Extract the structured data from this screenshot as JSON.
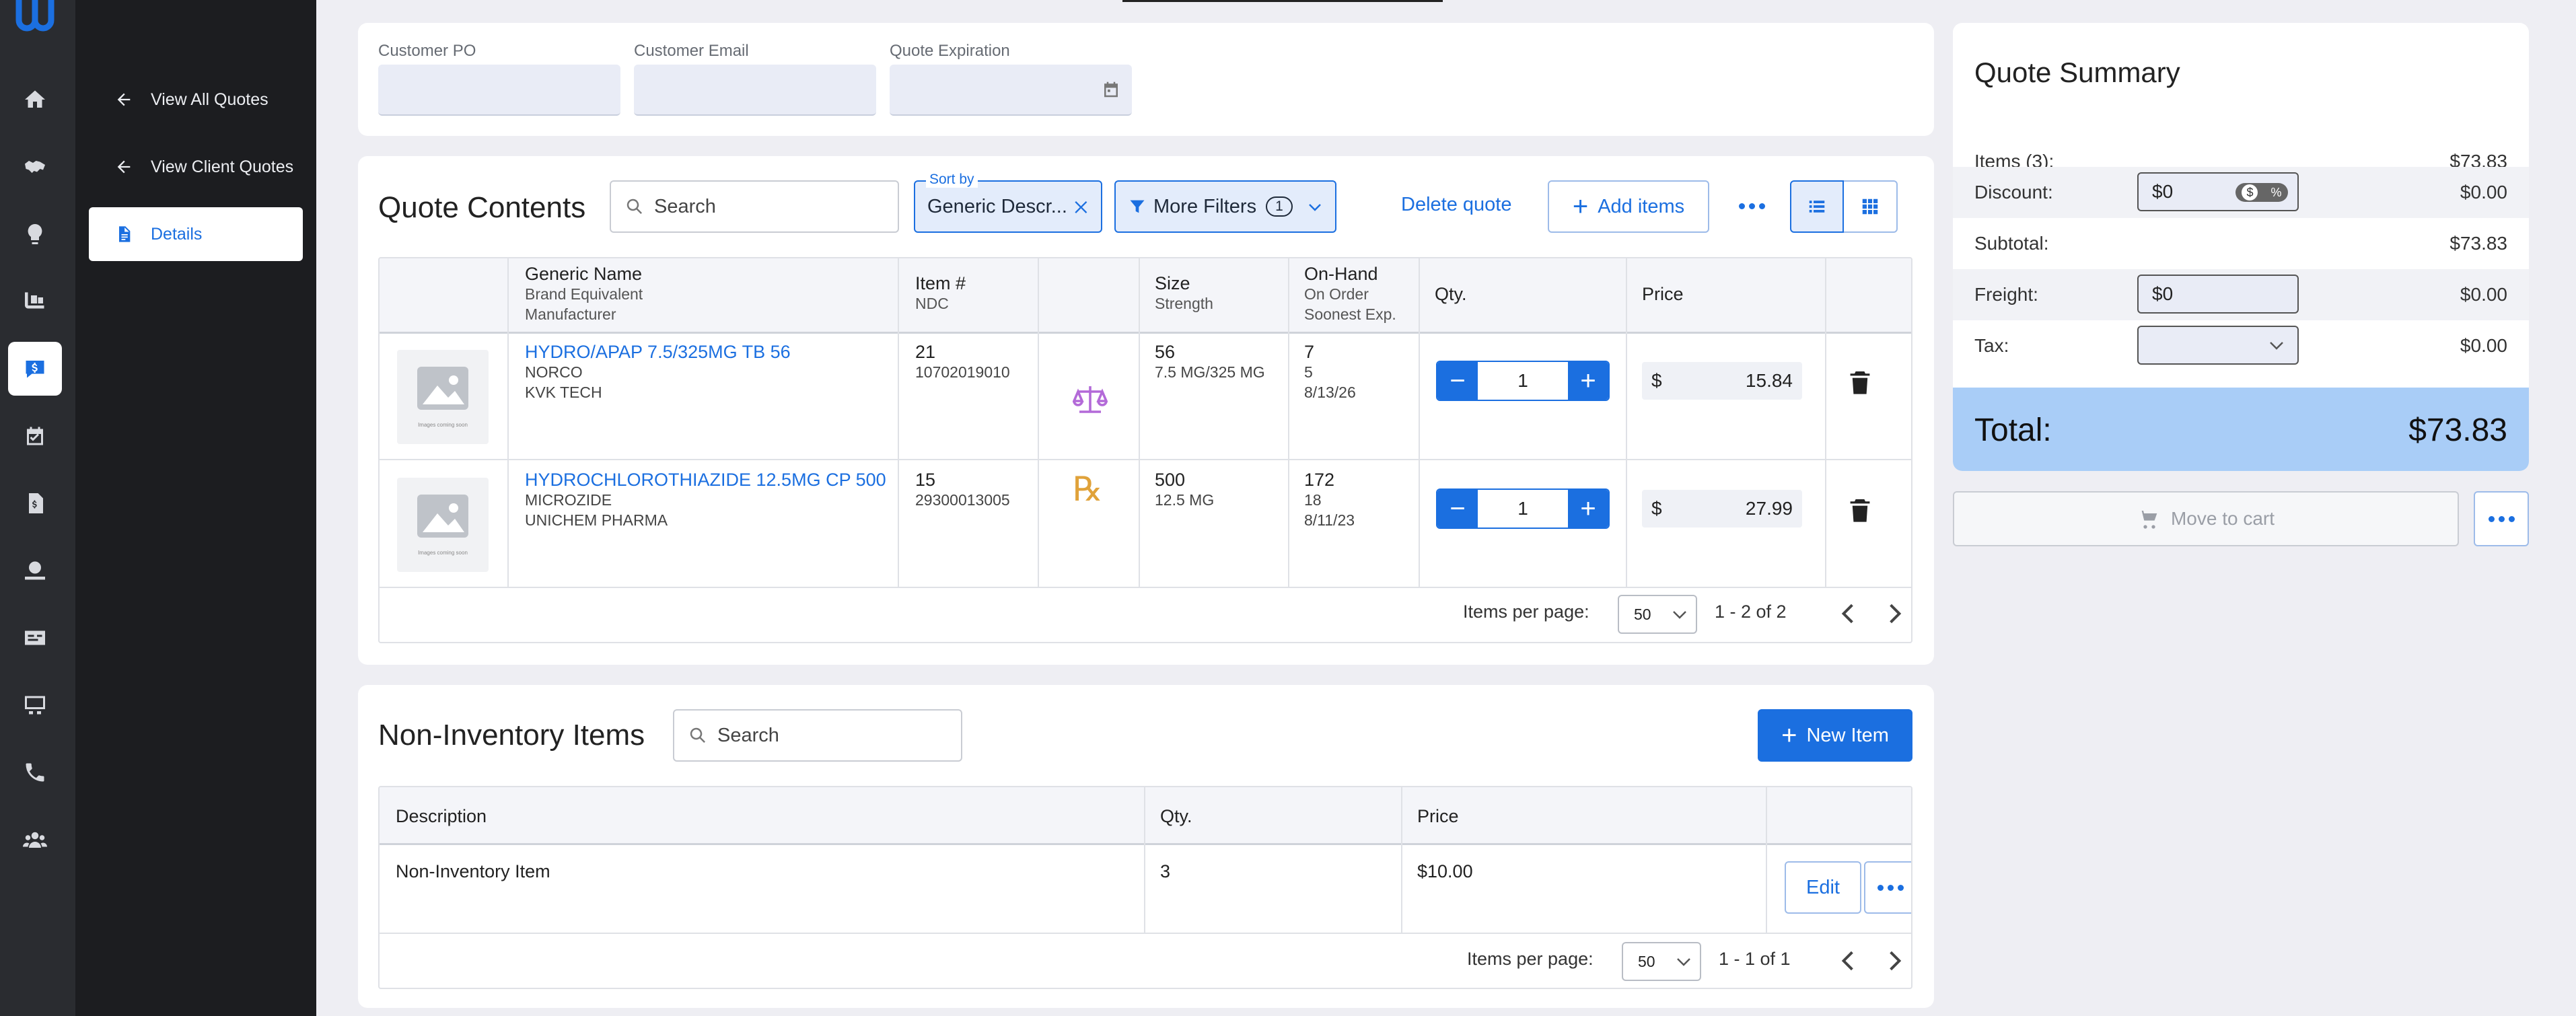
{
  "sidebar": {
    "back_all_quotes": "View All Quotes",
    "back_client_quotes": "View Client Quotes",
    "details": "Details"
  },
  "quote_info": {
    "po_label": "Customer PO",
    "po_value": "",
    "email_label": "Customer Email",
    "email_value": "",
    "expiration_label": "Quote Expiration",
    "expiration_value": ""
  },
  "quote_contents": {
    "title": "Quote Contents",
    "search_placeholder": "Search",
    "sort_legend": "Sort by",
    "sort_value": "Generic Descr...",
    "more_filters_label": "More Filters",
    "more_filters_count": "1",
    "delete_label": "Delete quote",
    "add_items_label": "Add items",
    "headers": {
      "generic": "Generic Name",
      "brand": "Brand Equivalent",
      "manufacturer": "Manufacturer",
      "item": "Item #",
      "ndc": "NDC",
      "size": "Size",
      "strength": "Strength",
      "onhand": "On-Hand",
      "onorder": "On Order",
      "soonest": "Soonest Exp.",
      "qty": "Qty.",
      "price": "Price"
    },
    "rows": [
      {
        "name": "HYDRO/APAP 7.5/325MG TB 56",
        "brand": "NORCO",
        "manufacturer": "KVK TECH",
        "item_no": "21",
        "ndc": "10702019010",
        "badge_icon": "scale-icon",
        "size": "56",
        "strength": "7.5 MG/325 MG",
        "on_hand": "7",
        "on_order": "5",
        "soonest_exp": "8/13/26",
        "qty": "1",
        "currency": "$",
        "price": "15.84"
      },
      {
        "name": "HYDROCHLOROTHIAZIDE 12.5MG CP 500",
        "brand": "MICROZIDE",
        "manufacturer": "UNICHEM PHARMA",
        "item_no": "15",
        "ndc": "29300013005",
        "badge_icon": "rx-icon",
        "badge_text": "℞",
        "size": "500",
        "strength": "12.5 MG",
        "on_hand": "172",
        "on_order": "18",
        "soonest_exp": "8/11/23",
        "qty": "1",
        "currency": "$",
        "price": "27.99"
      }
    ],
    "items_per_page_label": "Items per page:",
    "items_per_page": "50",
    "range": "1 - 2 of 2"
  },
  "non_inventory": {
    "title": "Non-Inventory Items",
    "search_placeholder": "Search",
    "new_item_label": "New Item",
    "headers": {
      "description": "Description",
      "qty": "Qty.",
      "price": "Price"
    },
    "rows": [
      {
        "description": "Non-Inventory Item",
        "qty": "3",
        "price": "$10.00",
        "edit_label": "Edit"
      }
    ],
    "items_per_page_label": "Items per page:",
    "items_per_page": "50",
    "range": "1 - 1 of 1"
  },
  "summary": {
    "title": "Quote Summary",
    "items_label": "Items (3):",
    "items_value": "$73.83",
    "discount_label": "Discount:",
    "discount_input": "$0",
    "discount_value": "$0.00",
    "subtotal_label": "Subtotal:",
    "subtotal_value": "$73.83",
    "freight_label": "Freight:",
    "freight_input": "$0",
    "freight_value": "$0.00",
    "tax_label": "Tax:",
    "tax_input": "",
    "tax_value": "$0.00",
    "total_label": "Total:",
    "total_value": "$73.83",
    "move_to_cart_label": "Move to cart"
  },
  "colors": {
    "accent": "#1b6fe0",
    "rail": "#2a2c30",
    "subnav": "#1c1d20",
    "total_bar": "#a9cdf7"
  }
}
